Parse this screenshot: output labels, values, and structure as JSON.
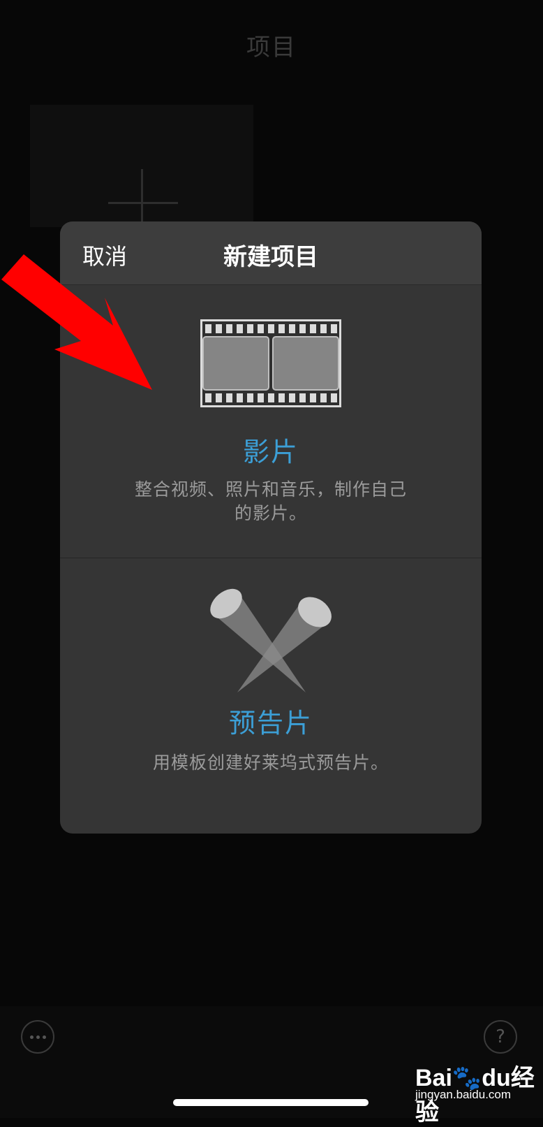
{
  "page": {
    "title": "项目"
  },
  "modal": {
    "cancel_label": "取消",
    "title": "新建项目",
    "options": [
      {
        "icon": "film-strip-icon",
        "name": "影片",
        "description": "整合视频、照片和音乐，制作自己的影片。"
      },
      {
        "icon": "spotlights-icon",
        "name": "预告片",
        "description": "用模板创建好莱坞式预告片。"
      }
    ]
  },
  "bottom": {
    "help_label": "?"
  },
  "watermark": {
    "logo_left": "Bai",
    "logo_right": "du",
    "logo_cn": "经验",
    "sub": "jingyan.baidu.com"
  },
  "colors": {
    "accent": "#3c9fd6",
    "arrow": "#ff0000",
    "modal_bg": "#353535",
    "background": "#070707"
  }
}
